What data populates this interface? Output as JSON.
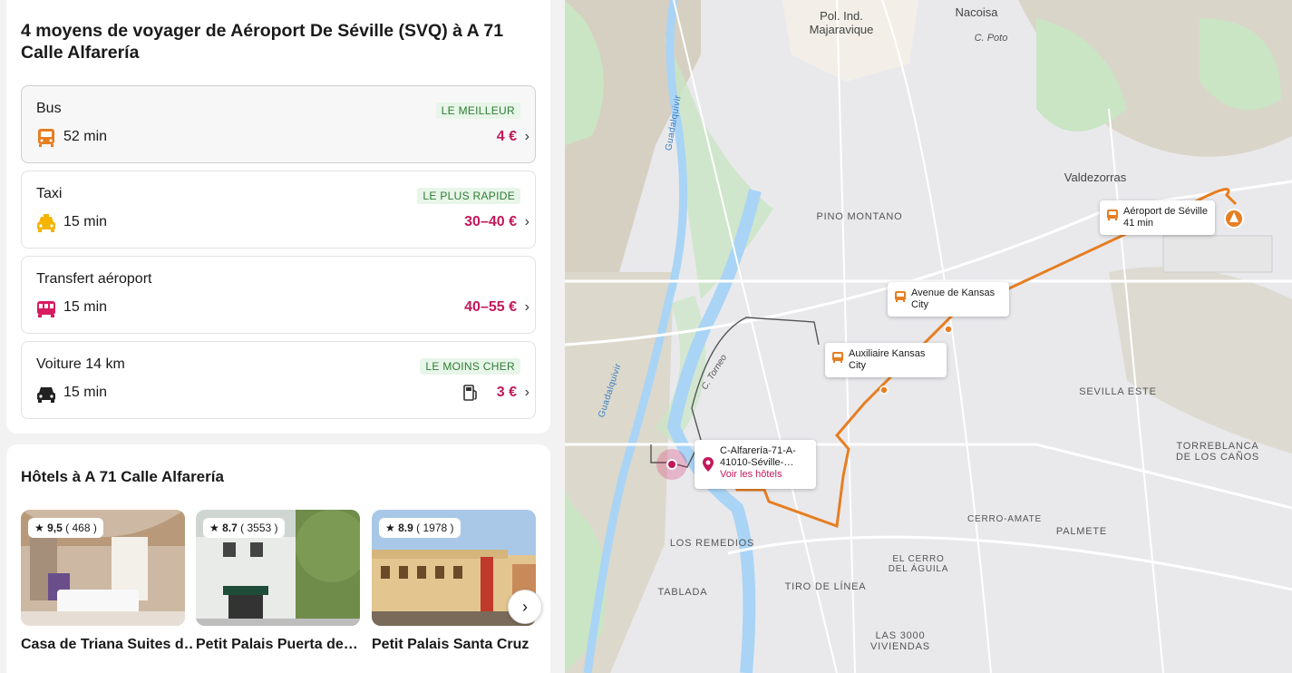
{
  "panel": {
    "title": "4 moyens de voyager de Aéroport De Séville (SVQ) à A 71 Calle Alfarería",
    "options": [
      {
        "name": "Bus",
        "badge": "LE MEILLEUR",
        "duration": "52 min",
        "price": "4 €",
        "icon": "bus-icon",
        "icon_color": "#e67e22"
      },
      {
        "name": "Taxi",
        "badge": "LE PLUS RAPIDE",
        "duration": "15 min",
        "price": "30–40 €",
        "icon": "taxi-icon",
        "icon_color": "#f5b400"
      },
      {
        "name": "Transfert aéroport",
        "badge": "",
        "duration": "15 min",
        "price": "40–55 €",
        "icon": "shuttle-icon",
        "icon_color": "#d81b60"
      },
      {
        "name": "Voiture 14 km",
        "badge": "LE MOINS CHER",
        "duration": "15 min",
        "price": "3 €",
        "icon": "car-icon",
        "icon_color": "#222222"
      }
    ]
  },
  "hotels": {
    "title": "Hôtels à A 71 Calle Alfarería",
    "items": [
      {
        "rating": "9,5",
        "reviews": "( 468 )",
        "name": "Casa de Triana Suites d…"
      },
      {
        "rating": "8.7",
        "reviews": "( 3553 )",
        "name": "Petit Palais Puerta de…"
      },
      {
        "rating": "8.9",
        "reviews": "( 1978 )",
        "name": "Petit Palais Santa Cruz"
      }
    ],
    "next_icon": "chevron-right-icon"
  },
  "map": {
    "labels": {
      "pol_ind": "Pol. Ind.",
      "majaravique": "Majaravique",
      "nacoisa": "Nacoisa",
      "c_poto": "C. Poto",
      "valdezorras": "Valdezorras",
      "pino_montano": "PINO MONTANO",
      "sevilla_este": "SEVILLA ESTE",
      "torreblanca": "TORREBLANCA",
      "de_los_canos": "DE LOS CAÑOS",
      "cerro_amate": "CERRO-AMATE",
      "palmete": "PALMETE",
      "el_cerro": "EL CERRO",
      "del_aguila": "DEL ÁGUILA",
      "los_remedios": "LOS REMEDIOS",
      "tablada": "TABLADA",
      "tiro_de_linea": "TIRO DE LÍNEA",
      "las_3000": "LAS 3000",
      "viviendas": "VIVIENDAS",
      "guadalquivir": "Guadalquivir",
      "c_torneo": "C. Torneo"
    },
    "popups": {
      "airport_name": "Aéroport de Séville",
      "airport_time": "41 min",
      "kansas_name": "Avenue de Kansas",
      "kansas_city": "City",
      "aux_name": "Auxiliaire Kansas",
      "aux_city": "City"
    },
    "destination": {
      "line1": "C-Alfarería-71-A-",
      "line2": "41010-Séville-…",
      "link": "Voir les hôtels"
    },
    "route_color": "#e67e22"
  }
}
